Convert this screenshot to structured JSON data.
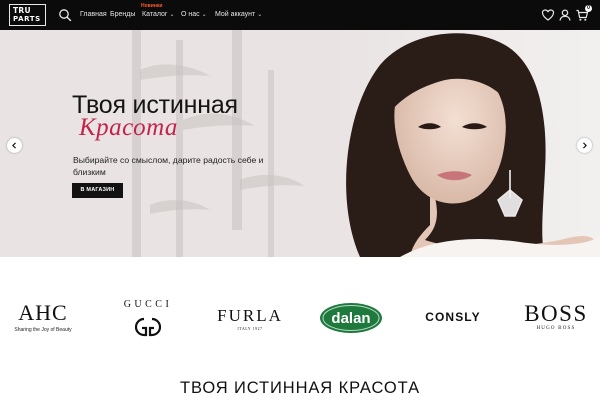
{
  "header": {
    "logo": {
      "line1": "TRU",
      "line2": "PARTS"
    },
    "nav": [
      {
        "label": "Главная",
        "has_dropdown": false
      },
      {
        "label": "Бренды",
        "has_dropdown": false
      },
      {
        "label": "Каталог",
        "has_dropdown": true,
        "badge": "Новинки"
      },
      {
        "label": "О нас",
        "has_dropdown": true
      },
      {
        "label": "Мой аккаунт",
        "has_dropdown": true
      }
    ],
    "icons": [
      "search-icon",
      "heart-icon",
      "user-icon",
      "cart-icon"
    ],
    "cart_count": "0"
  },
  "hero": {
    "title": "Твоя истинная",
    "script_title": "Красота",
    "subtitle": "Выбирайте со смыслом, дарите радость себе и близким",
    "button": "В МАГАЗИН",
    "colors": {
      "accent": "#c3244b",
      "background": "#e9e4e3",
      "button": "#121212"
    }
  },
  "brands": {
    "ahc": {
      "name": "AHC",
      "tagline": "Sharing the Joy of Beauty"
    },
    "gucci": {
      "name": "GUCCI"
    },
    "furla": {
      "name": "FURLA",
      "tagline": "ITALY 1927"
    },
    "dalan": {
      "name": "dalan",
      "color": "#1d7a3c"
    },
    "consly": {
      "name": "CONSLY"
    },
    "boss": {
      "name": "BOSS",
      "tagline": "HUGO BOSS"
    }
  },
  "section": {
    "title": "ТВОЯ ИСТИННАЯ КРАСОТА"
  }
}
